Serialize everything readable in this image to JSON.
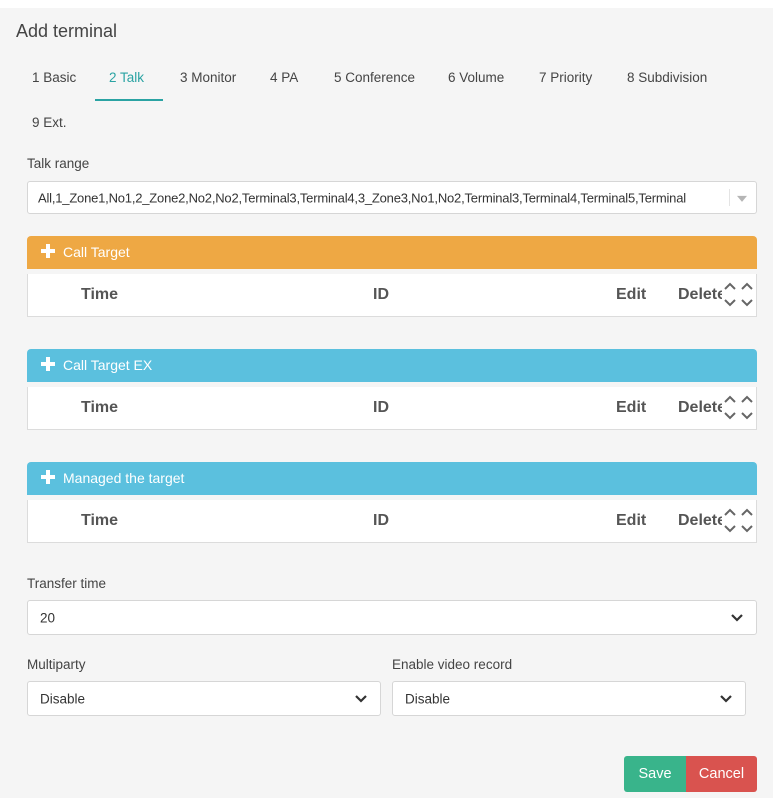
{
  "dialog": {
    "title": "Add terminal"
  },
  "tabs": [
    {
      "label": "1 Basic"
    },
    {
      "label": "2 Talk"
    },
    {
      "label": "3 Monitor"
    },
    {
      "label": "4 PA"
    },
    {
      "label": "5 Conference"
    },
    {
      "label": "6 Volume"
    },
    {
      "label": "7 Priority"
    },
    {
      "label": "8 Subdivision"
    },
    {
      "label": "9 Ext."
    }
  ],
  "active_tab": "2 Talk",
  "talk_range": {
    "label": "Talk range",
    "value": "All,1_Zone1,No1,2_Zone2,No2,No2,Terminal3,Terminal4,3_Zone3,No1,No2,Terminal3,Terminal4,Terminal5,Terminal"
  },
  "panels": [
    {
      "title": "Call Target",
      "color": "#eea844"
    },
    {
      "title": "Call Target EX",
      "color": "#5bc0de"
    },
    {
      "title": "Managed the target",
      "color": "#5bc0de"
    }
  ],
  "grid_columns": {
    "time": "Time",
    "id": "ID",
    "edit": "Edit",
    "delete": "Delete"
  },
  "transfer_time": {
    "label": "Transfer time",
    "value": "20"
  },
  "multiparty": {
    "label": "Multiparty",
    "value": "Disable"
  },
  "video_record": {
    "label": "Enable video record",
    "value": "Disable"
  },
  "buttons": {
    "save": "Save",
    "cancel": "Cancel"
  },
  "icons": {
    "panel_add": "plus-icon",
    "select": "chevron-down-icon",
    "sort": "sort-arrows-icon"
  }
}
